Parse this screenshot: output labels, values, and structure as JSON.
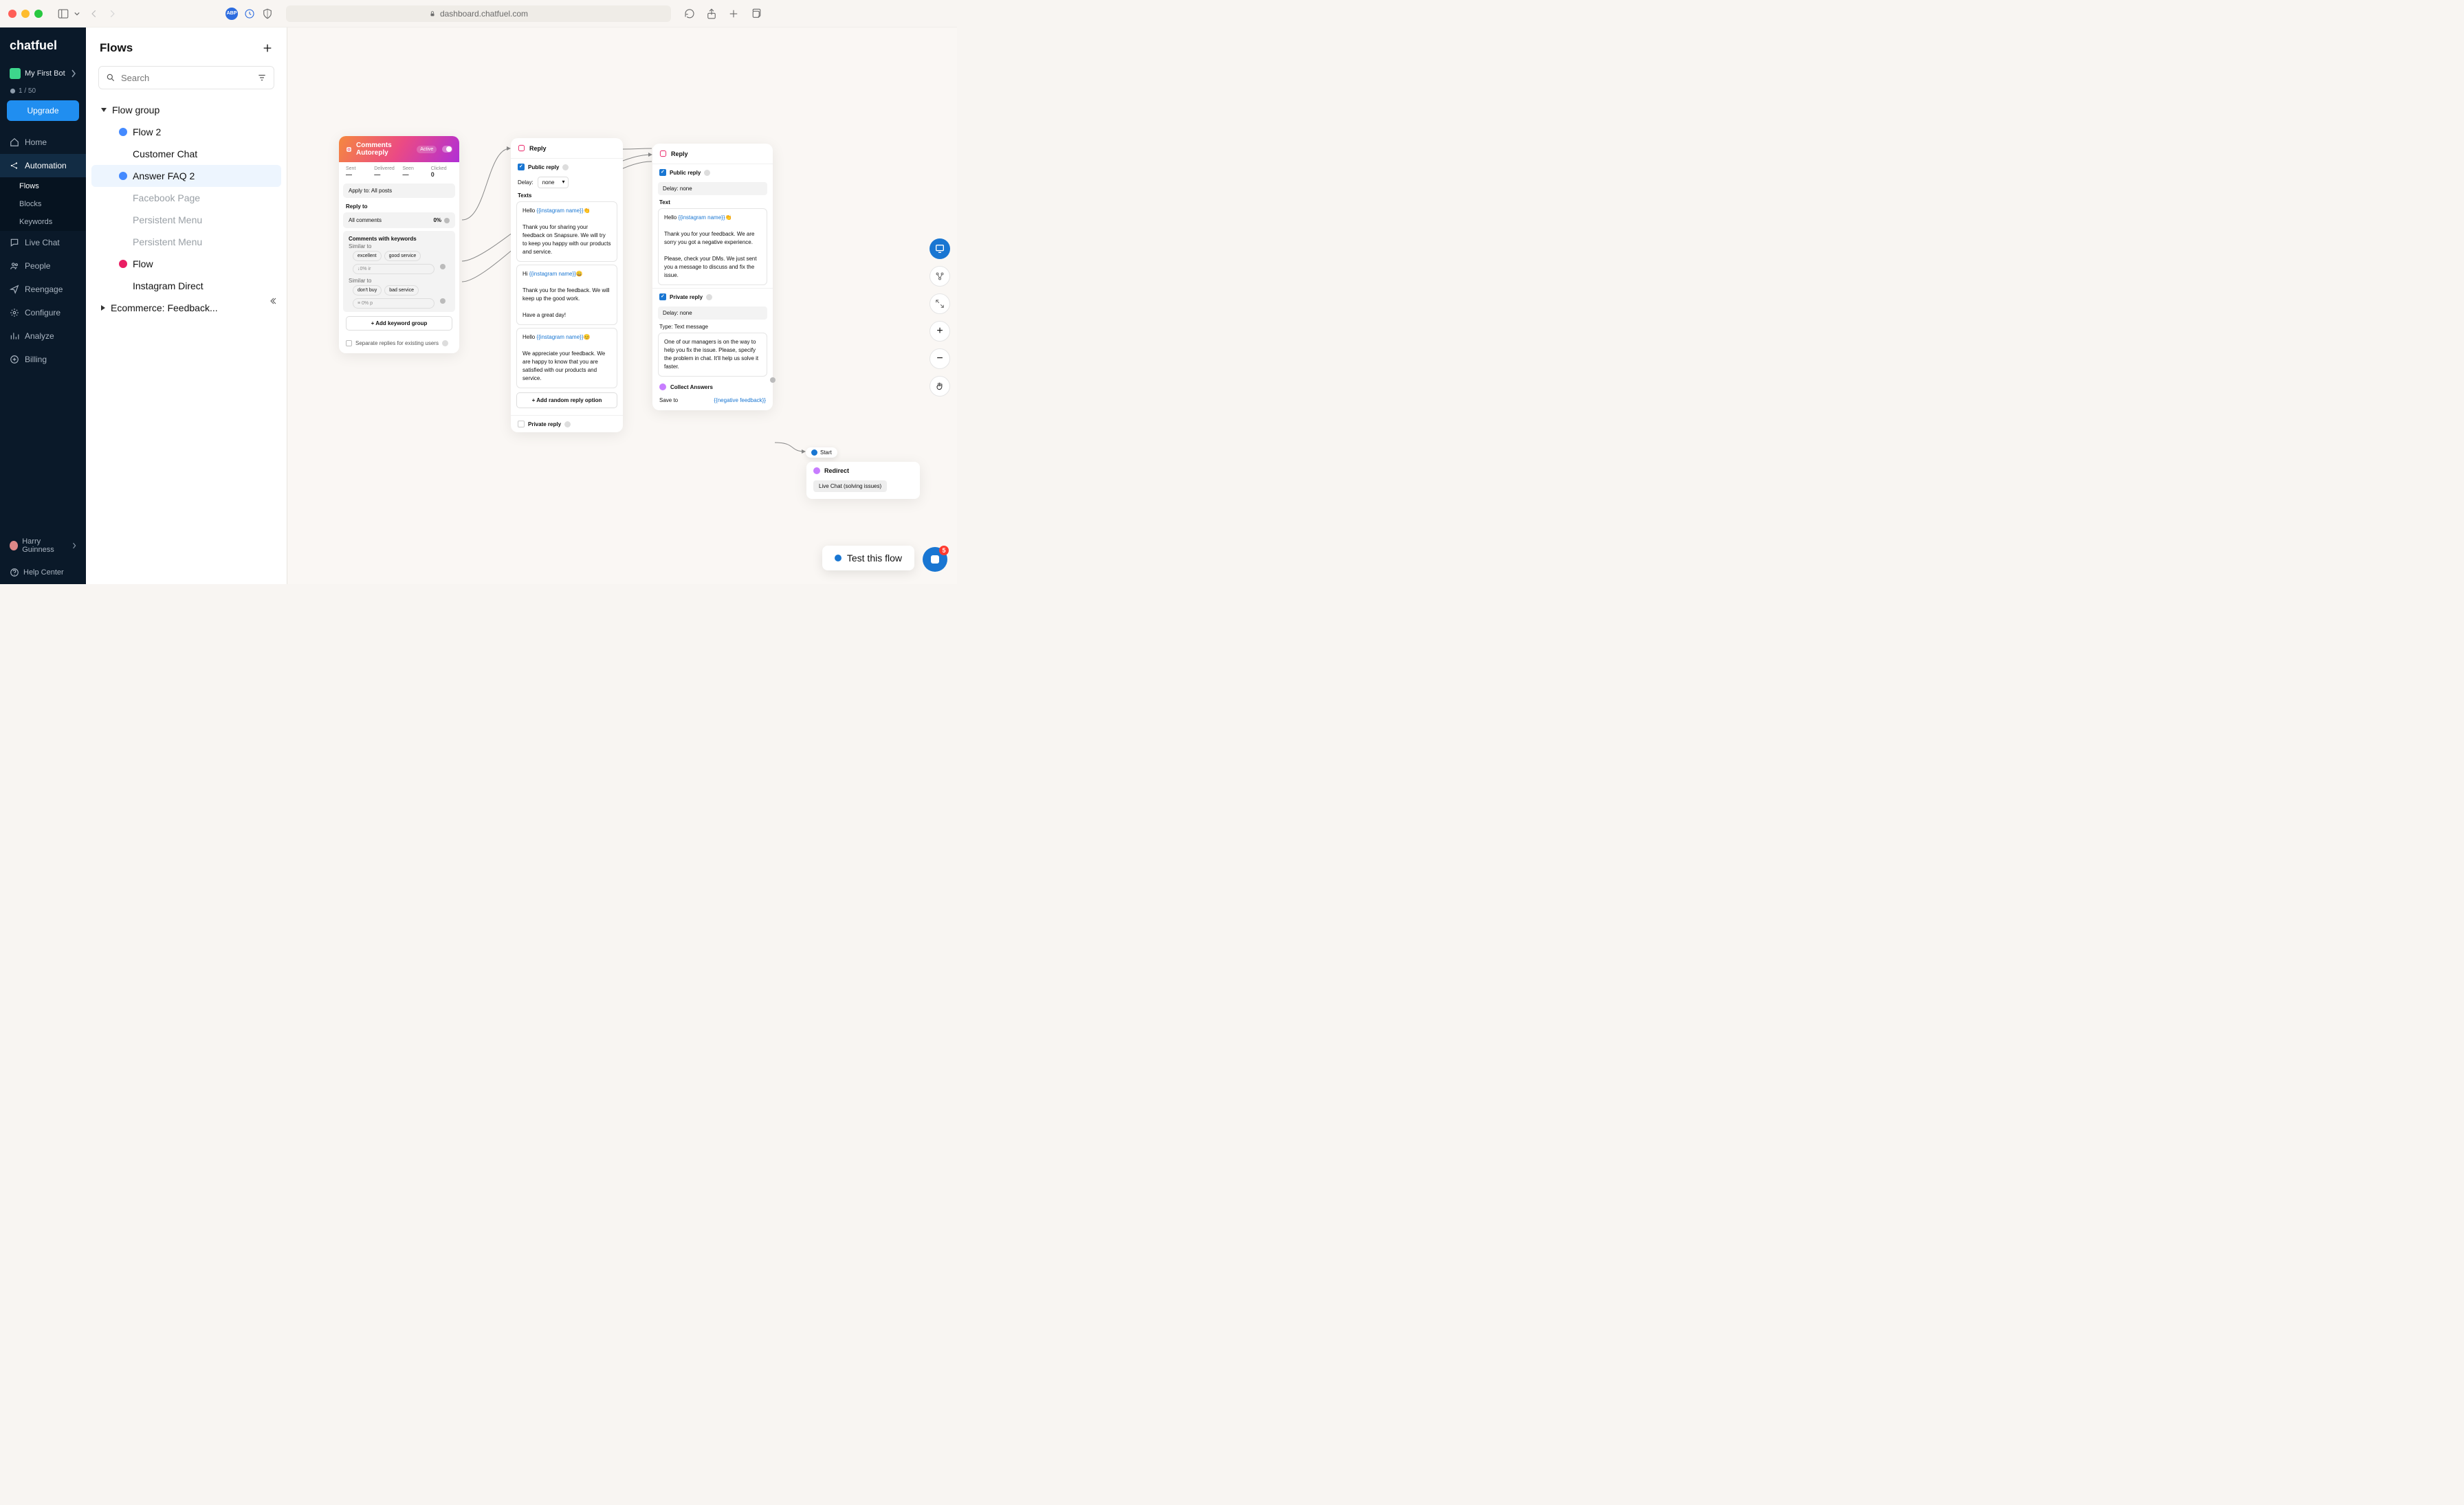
{
  "browser": {
    "url": "dashboard.chatfuel.com",
    "ext_abp": "ABP"
  },
  "sidebar": {
    "logo": "chatfuel",
    "bot_name": "My First Bot",
    "bot_count": "1 / 50",
    "upgrade": "Upgrade",
    "items": [
      {
        "label": "Home",
        "icon": "home"
      },
      {
        "label": "Automation",
        "icon": "share"
      },
      {
        "label": "Live Chat",
        "icon": "chat"
      },
      {
        "label": "People",
        "icon": "people"
      },
      {
        "label": "Reengage",
        "icon": "send"
      },
      {
        "label": "Configure",
        "icon": "gear"
      },
      {
        "label": "Analyze",
        "icon": "chart"
      },
      {
        "label": "Billing",
        "icon": "plus-circle"
      }
    ],
    "sub_items": [
      "Flows",
      "Blocks",
      "Keywords"
    ],
    "user": "Harry Guinness",
    "help": "Help Center"
  },
  "flows_panel": {
    "title": "Flows",
    "search_placeholder": "Search",
    "groups": [
      {
        "label": "Flow group",
        "expanded": true,
        "items": [
          {
            "label": "Flow 2",
            "dot": "blue"
          },
          {
            "label": "Customer Chat"
          },
          {
            "label": "Answer FAQ 2",
            "dot": "blue",
            "selected": true
          },
          {
            "label": "Facebook Page",
            "dim": true
          },
          {
            "label": "Persistent Menu",
            "dim": true
          },
          {
            "label": "Persistent Menu",
            "dim": true
          },
          {
            "label": "Flow",
            "dot": "pink"
          },
          {
            "label": "Instagram Direct"
          }
        ]
      },
      {
        "label": "Ecommerce: Feedback...",
        "expanded": false
      }
    ]
  },
  "comments_card": {
    "title": "Comments Autoreply",
    "badge": "Active",
    "stats": [
      {
        "k": "Sent",
        "v": "—"
      },
      {
        "k": "Delivered",
        "v": "—"
      },
      {
        "k": "Seen",
        "v": "—"
      },
      {
        "k": "Clicked",
        "v": "0"
      }
    ],
    "apply_to": "Apply to: All posts",
    "reply_to": "Reply to",
    "all_comments": "All comments",
    "all_comments_pct": "0%",
    "kw_title": "Comments with keywords",
    "similar_to": "Similar to",
    "kw_group1": [
      "excellent",
      "good service",
      "↓0% ir"
    ],
    "kw_group2": [
      "don't buy",
      "bad service",
      "≡ 0% p"
    ],
    "add_kw": "+  Add keyword group",
    "separate": "Separate replies for existing users"
  },
  "reply1": {
    "title": "Reply",
    "public": "Public reply",
    "delay_lbl": "Delay:",
    "delay_val": "none",
    "texts": "Texts",
    "msgs": [
      {
        "pre": "Hello ",
        "var": "{{instagram name}}",
        "post": "👏\n\nThank you for sharing your feedback on Snapsure. We will try to keep you happy with our products and service."
      },
      {
        "pre": "Hi ",
        "var": "{{instagram name}}",
        "post": "😀\n\nThank you for the feedback. We will keep up the good work.\n\nHave a great day!"
      },
      {
        "pre": "Hello ",
        "var": "{{instagram name}}",
        "post": "😊\n\nWe appreciate your feedback. We are happy to know that you are satisfied with our products and service."
      }
    ],
    "add_random": "+  Add random reply option",
    "private": "Private reply"
  },
  "reply2": {
    "title": "Reply",
    "public": "Public reply",
    "delay_plain": "Delay: none",
    "text_lbl": "Text",
    "msg1_pre": "Hello ",
    "msg1_var": "{{instagram name}}",
    "msg1_post": "👏\n\nThank you for your feedback. We are sorry you got a negative experience.\n\nPlease, check your DMs. We just sent you a message to discuss and fix the issue.",
    "private": "Private reply",
    "delay_plain2": "Delay: none",
    "type": "Type:  Text message",
    "msg2": "One of our managers is on the way to help you fix the issue. Please, specify the problem in chat. It'll help us solve it faster.",
    "collect": "Collect Answers",
    "save_to": "Save to",
    "save_val": "{{negative feedback}}"
  },
  "redirect": {
    "start": "Start",
    "title": "Redirect",
    "chip": "Live Chat (solving issues)"
  },
  "test_flow": "Test this flow",
  "chat_badge": "5"
}
